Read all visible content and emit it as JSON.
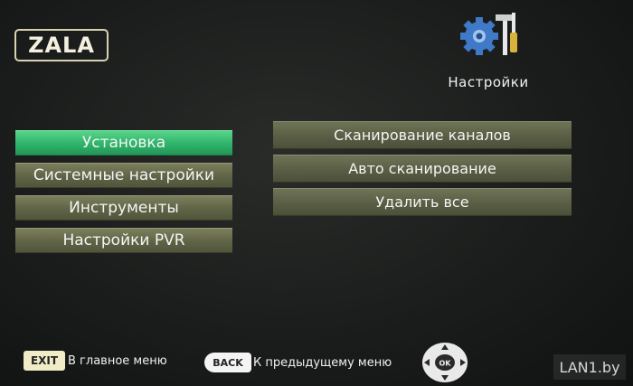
{
  "brand": {
    "logo_text": "ZALA"
  },
  "header": {
    "title": "Настройки",
    "icon": "settings-gear-tools-icon"
  },
  "left_menu": {
    "items": [
      {
        "label": "Установка",
        "active": true
      },
      {
        "label": "Системные настройки",
        "active": false
      },
      {
        "label": "Инструменты",
        "active": false
      },
      {
        "label": "Настройки PVR",
        "active": false
      }
    ]
  },
  "right_menu": {
    "items": [
      {
        "label": "Сканирование каналов"
      },
      {
        "label": "Авто сканирование"
      },
      {
        "label": "Удалить все"
      }
    ]
  },
  "footer": {
    "exit_key": "EXIT",
    "exit_label": "В главное меню",
    "back_key": "BACK",
    "back_label": "К предыдущему меню",
    "nav_key": "OK"
  },
  "watermark": "LAN1.by",
  "colors": {
    "active_item": "#2fb36a",
    "inactive_item": "#5f6446",
    "background": "#1b1d1c"
  }
}
